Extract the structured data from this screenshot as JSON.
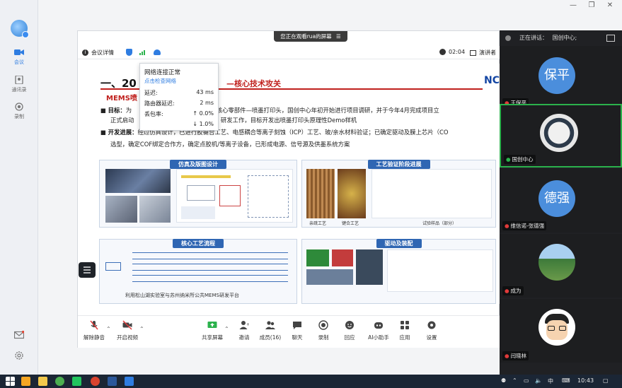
{
  "left_rail": {
    "items": [
      {
        "label": "会议",
        "icon": "camera-icon",
        "active": true
      },
      {
        "label": "通讯录",
        "icon": "contacts-icon",
        "active": false
      },
      {
        "label": "录制",
        "icon": "record-icon",
        "active": false
      }
    ]
  },
  "banner": {
    "text": "您正在观看rua的屏幕",
    "icon": "menu-icon"
  },
  "meeting_bar": {
    "details_label": "会议详情",
    "timer": "02:04",
    "speaker_view_label": "演讲者"
  },
  "network_popover": {
    "status": "网络连接正常",
    "check_link": "点击检查网络",
    "rows": [
      {
        "label": "延迟:",
        "value": "43 ms"
      },
      {
        "label": "路由器延迟:",
        "value": "2 ms"
      },
      {
        "label": "丢包率:",
        "value": "↑ 0.0%"
      },
      {
        "label": "",
        "value": "↓ 1.0%"
      }
    ]
  },
  "slide": {
    "title": "一、20",
    "subtitle": "—核心技术攻关",
    "logo": "NC",
    "section": "MEMS喷",
    "goal_label": "目标：",
    "goal_text_1": "为",
    "goal_text_1b": "打印机的核心零部件—喷墨打印头，国创中心年初开始进行项目调研，并于今年4月完成项目立",
    "goal_text_2a": "正式启动",
    "goal_text_2b": "4~2025年）研发工作，目标开发出喷墨打印头原理性Demo样机",
    "progress_label": "开发进展：",
    "progress_text_1": "经过仿真设计，已进行胶键合工艺、电感耦合等离子刻蚀（ICP）工艺、玻/亲水材料验证；已确定驱动及膜上芯片（CO",
    "progress_text_2": "选型，确定COF绑定合作方，确定点胶机/等离子设备，已形成电源、信号源及供墨系统方案",
    "panels": [
      {
        "title": "仿真及版图设计"
      },
      {
        "title": "工艺验证阶段进展"
      },
      {
        "title": "核心工艺流程"
      },
      {
        "title": "驱动及装配"
      }
    ],
    "captions": [
      "亲疏工艺",
      "键合工艺",
      "试验样品（部分）"
    ],
    "platform_caption": "利用松山湖实验室与苏州纳米所公共MEMS研发平台"
  },
  "toolbar": {
    "buttons": [
      {
        "label": "解除静音",
        "icon": "mic-muted-icon"
      },
      {
        "label": "开启视频",
        "icon": "camera-off-icon"
      },
      {
        "label": "共享屏幕",
        "icon": "share-screen-icon"
      },
      {
        "label": "邀请",
        "icon": "invite-icon"
      },
      {
        "label": "成员(16)",
        "icon": "members-icon"
      },
      {
        "label": "聊天",
        "icon": "chat-icon"
      },
      {
        "label": "录制",
        "icon": "record-icon"
      },
      {
        "label": "回应",
        "icon": "reaction-icon"
      },
      {
        "label": "AI小助手",
        "icon": "ai-assistant-icon"
      },
      {
        "label": "应用",
        "icon": "apps-icon"
      },
      {
        "label": "设置",
        "icon": "settings-icon"
      }
    ]
  },
  "right_panel": {
    "speaking_label": "正在讲话：",
    "speaking_name": "国创中心;",
    "tiles": [
      {
        "avatar_text": "保平",
        "name": "王保平",
        "kind": "avatar",
        "color": "#4b8edc"
      },
      {
        "avatar_text": "",
        "name": "国创中心",
        "kind": "photo",
        "active": true
      },
      {
        "avatar_text": "德强",
        "name": "维信诺-张德强",
        "kind": "avatar",
        "color": "#4b8edc"
      },
      {
        "avatar_text": "",
        "name": "成为",
        "kind": "photo"
      },
      {
        "avatar_text": "",
        "name": "闫晓林",
        "kind": "cartoon"
      }
    ]
  },
  "taskbar": {
    "input_method": "中",
    "time": "10:43"
  },
  "colors": {
    "accent": "#2f7de1",
    "slide_red": "#c0201d",
    "panel_blue": "#2f66b3",
    "active_tile": "#2bb24c"
  }
}
